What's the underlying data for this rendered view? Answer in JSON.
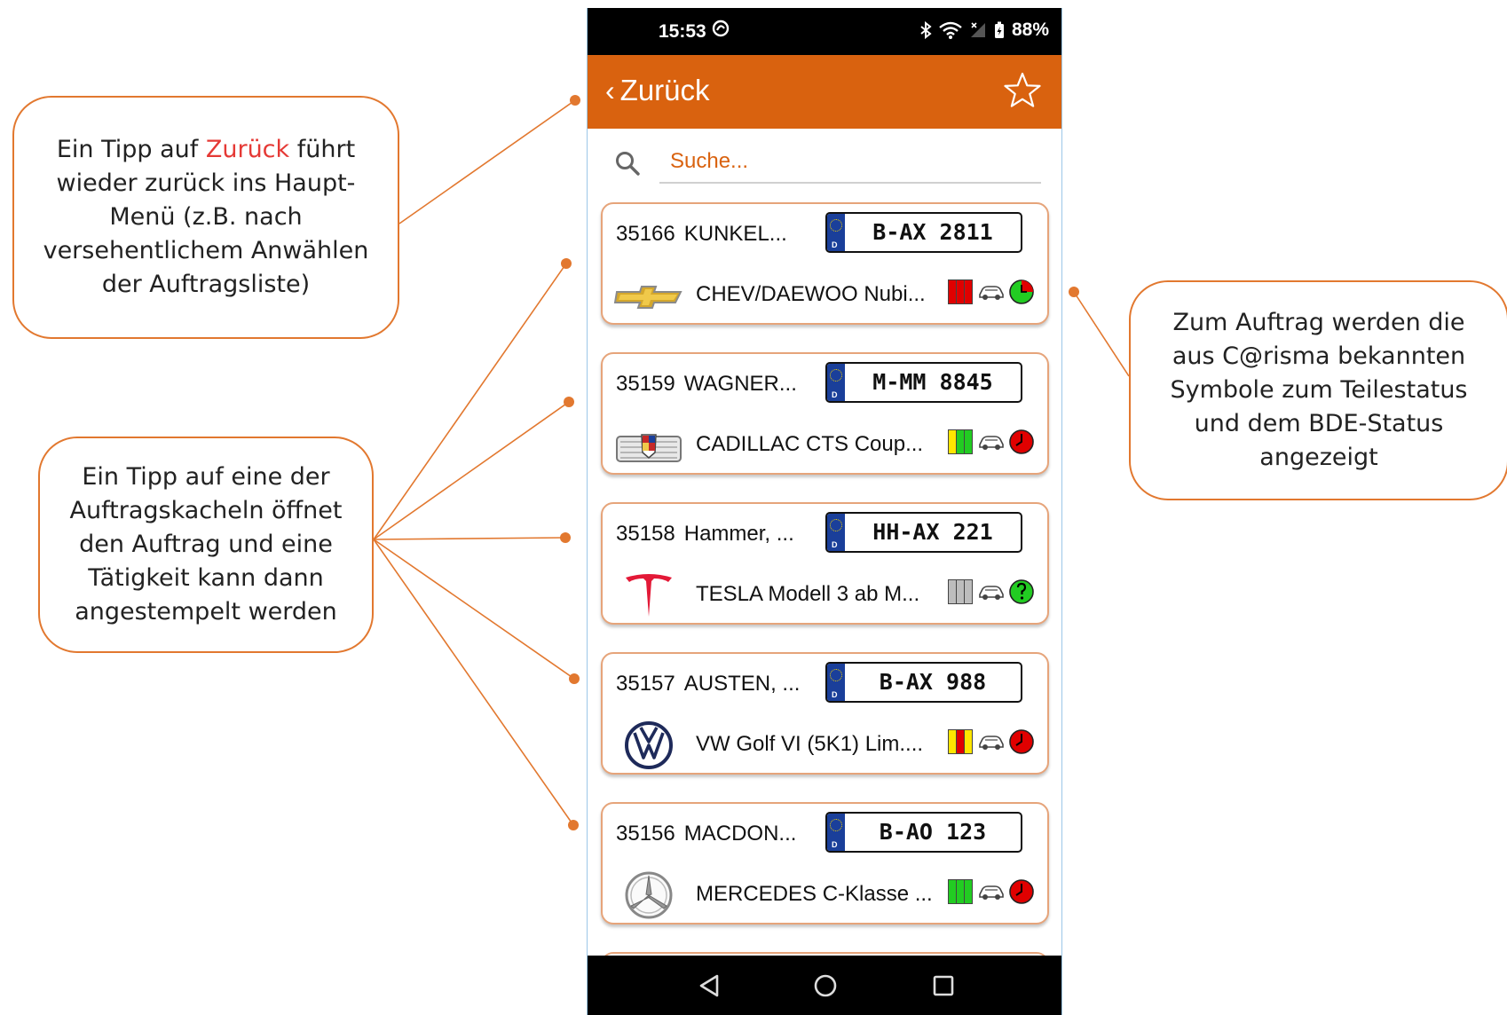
{
  "status_bar": {
    "time": "15:53",
    "battery": "88%"
  },
  "app_bar": {
    "back_label": "Zurück",
    "favorite_icon": "star-outline-icon"
  },
  "search": {
    "placeholder": "Suche..."
  },
  "orders": [
    {
      "number": "35166",
      "customer": "KUNKEL...",
      "plate": "B-AX 2811",
      "vehicle": "CHEV/DAEWOO Nubi...",
      "brand": "chevrolet-logo",
      "parts_status": [
        "#E00000",
        "#E00000",
        "#E00000"
      ],
      "bde_status": "clock-green-red-icon"
    },
    {
      "number": "35159",
      "customer": "WAGNER...",
      "plate": "M-MM 8845",
      "vehicle": "CADILLAC CTS Coup...",
      "brand": "cadillac-logo",
      "parts_status": [
        "#FFE600",
        "#22CC22",
        "#22CC22"
      ],
      "bde_status": "clock-red-icon"
    },
    {
      "number": "35158",
      "customer": "Hammer, ...",
      "plate": "HH-AX 221",
      "vehicle": "TESLA Modell 3 ab M...",
      "brand": "tesla-logo",
      "parts_status": [
        "#BDBDBD",
        "#BDBDBD",
        "#BDBDBD"
      ],
      "bde_status": "clock-green-question-icon"
    },
    {
      "number": "35157",
      "customer": "AUSTEN, ...",
      "plate": "B-AX 988",
      "vehicle": "VW Golf VI (5K1) Lim....",
      "brand": "vw-logo",
      "parts_status": [
        "#FFE600",
        "#E00000",
        "#FFE600"
      ],
      "bde_status": "clock-red-icon"
    },
    {
      "number": "35156",
      "customer": "MACDON...",
      "plate": "B-AO 123",
      "vehicle": "MERCEDES C-Klasse ...",
      "brand": "mercedes-logo",
      "parts_status": [
        "#22CC22",
        "#22CC22",
        "#22CC22"
      ],
      "bde_status": "clock-red-icon"
    }
  ],
  "callouts": {
    "back_prefix": "Ein Tipp auf ",
    "back_highlight": "Zurück",
    "back_suffix": " führt wieder zurück ins Haupt-Menü (z.B. nach versehentlichem Anwählen der Auftragsliste)",
    "tiles": "Ein Tipp auf eine der Auftragskacheln öffnet den Auftrag und eine Tätigkeit kann dann angestempelt werden",
    "status": "Zum Auftrag werden die aus C@risma bekannten Symbole zum Teilestatus und dem BDE-Status angezeigt"
  },
  "colors": {
    "accent": "#D9620F",
    "callout_border": "#E2782F",
    "highlight_text": "#E53935"
  }
}
